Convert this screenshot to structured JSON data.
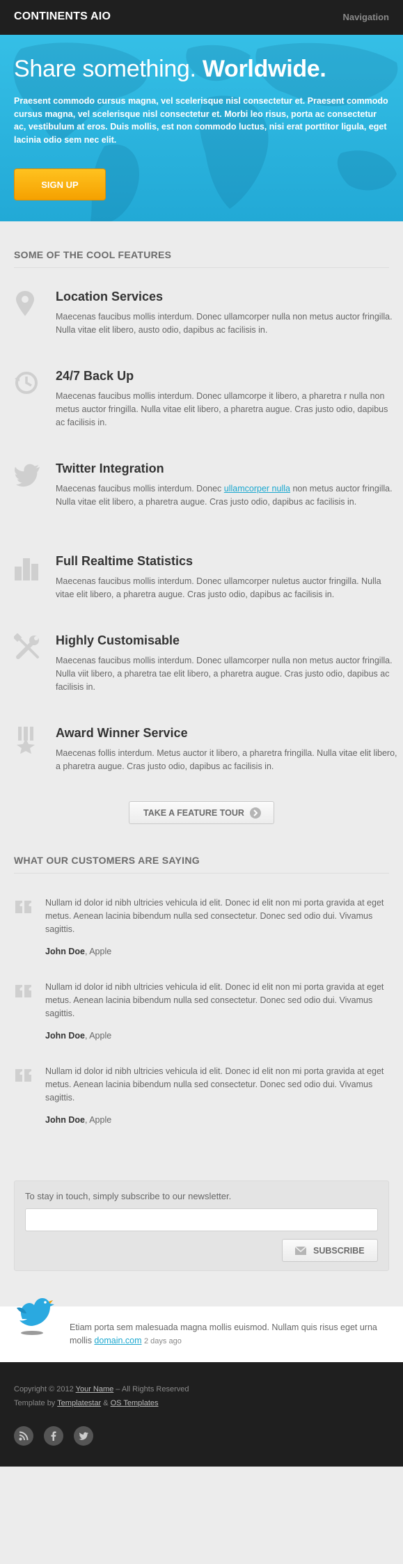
{
  "header": {
    "brand": "CONTINENTS AIO",
    "nav_label": "Navigation"
  },
  "hero": {
    "title_regular": "Share something.",
    "title_bold": "Worldwide.",
    "body": "Praesent commodo cursus magna, vel scelerisque nisl consectetur et. Praesent commodo cursus magna, vel scelerisque nisl consectetur et. Morbi leo risus, porta ac consectetur ac, vestibulum at eros. Duis mollis, est non commodo luctus, nisi erat porttitor ligula, eget lacinia odio sem nec elit.",
    "cta_label": "SIGN UP"
  },
  "features": {
    "heading": "SOME OF THE COOL FEATURES",
    "items": [
      {
        "icon": "location-pin-icon",
        "title": "Location Services",
        "body": "Maecenas faucibus mollis interdum. Donec ullamcorper nulla non metus auctor fringilla. Nulla vitae elit libero, austo odio, dapibus ac facilisis in."
      },
      {
        "icon": "clock-backup-icon",
        "title": "24/7 Back Up",
        "body": "Maecenas faucibus mollis interdum. Donec ullamcorpe it libero, a pharetra r nulla non metus auctor fringilla. Nulla vitae elit libero, a pharetra augue. Cras justo odio, dapibus ac facilisis in."
      },
      {
        "icon": "twitter-bird-icon",
        "title": "Twitter Integration",
        "body_before": "Maecenas faucibus mollis interdum. Donec ",
        "link": "ullamcorper nulla",
        "body_after": " non metus auctor fringilla. Nulla vitae elit libero, a pharetra augue. Cras justo odio, dapibus ac facilisis in."
      },
      {
        "icon": "bar-chart-icon",
        "title": "Full Realtime Statistics",
        "body": "Maecenas faucibus mollis interdum. Donec ullamcorper nuletus auctor fringilla. Nulla vitae elit libero, a pharetra augue. Cras justo odio, dapibus ac facilisis in."
      },
      {
        "icon": "tools-icon",
        "title": "Highly Customisable",
        "body": "Maecenas faucibus mollis interdum. Donec ullamcorper nulla non metus auctor fringilla. Nulla viit libero, a pharetra tae elit libero, a pharetra augue. Cras justo odio, dapibus ac facilisis in."
      },
      {
        "icon": "award-ribbon-icon",
        "title": "Award Winner Service",
        "body": "Maecenas follis interdum. Metus auctor it libero, a pharetra fringilla. Nulla vitae elit libero, a pharetra augue. Cras justo odio, dapibus ac facilisis in."
      }
    ],
    "tour_label": "TAKE A FEATURE TOUR"
  },
  "testimonials": {
    "heading": "WHAT OUR CUSTOMERS ARE SAYING",
    "items": [
      {
        "quote": "Nullam id dolor id nibh ultricies vehicula id elit. Donec id elit non mi porta gravida at eget metus. Aenean lacinia bibendum nulla sed consectetur. Donec sed odio dui. Vivamus sagittis.",
        "name": "John Doe",
        "company": ", Apple"
      },
      {
        "quote": "Nullam id dolor id nibh ultricies vehicula id elit. Donec id elit non mi porta gravida at eget metus. Aenean lacinia bibendum nulla sed consectetur. Donec sed odio dui. Vivamus sagittis.",
        "name": "John Doe",
        "company": ", Apple"
      },
      {
        "quote": "Nullam id dolor id nibh ultricies vehicula id elit. Donec id elit non mi porta gravida at eget metus. Aenean lacinia bibendum nulla sed consectetur. Donec sed odio dui. Vivamus sagittis.",
        "name": "John Doe",
        "company": ", Apple"
      }
    ]
  },
  "newsletter": {
    "text": "To stay in touch, simply subscribe to our newsletter.",
    "input_value": "",
    "button_label": "SUBSCRIBE"
  },
  "tweet": {
    "text": "Etiam porta sem malesuada magna mollis euismod. Nullam quis risus eget urna mollis ",
    "link": "domain.com",
    "time": "2 days ago"
  },
  "footer": {
    "copyright_prefix": "Copyright © 2012 ",
    "your_name": "Your Name",
    "copyright_suffix": " – All Rights Reserved",
    "template_prefix": "Template by ",
    "templatestar": "Templatestar",
    "amp": " & ",
    "os_templates": "OS Templates",
    "social": [
      "rss-icon",
      "facebook-icon",
      "twitter-icon"
    ]
  },
  "colors": {
    "accent": "#1aa7cf",
    "hero": "#28b3dd",
    "cta": "#ffb300",
    "dark": "#1f1f1f"
  }
}
